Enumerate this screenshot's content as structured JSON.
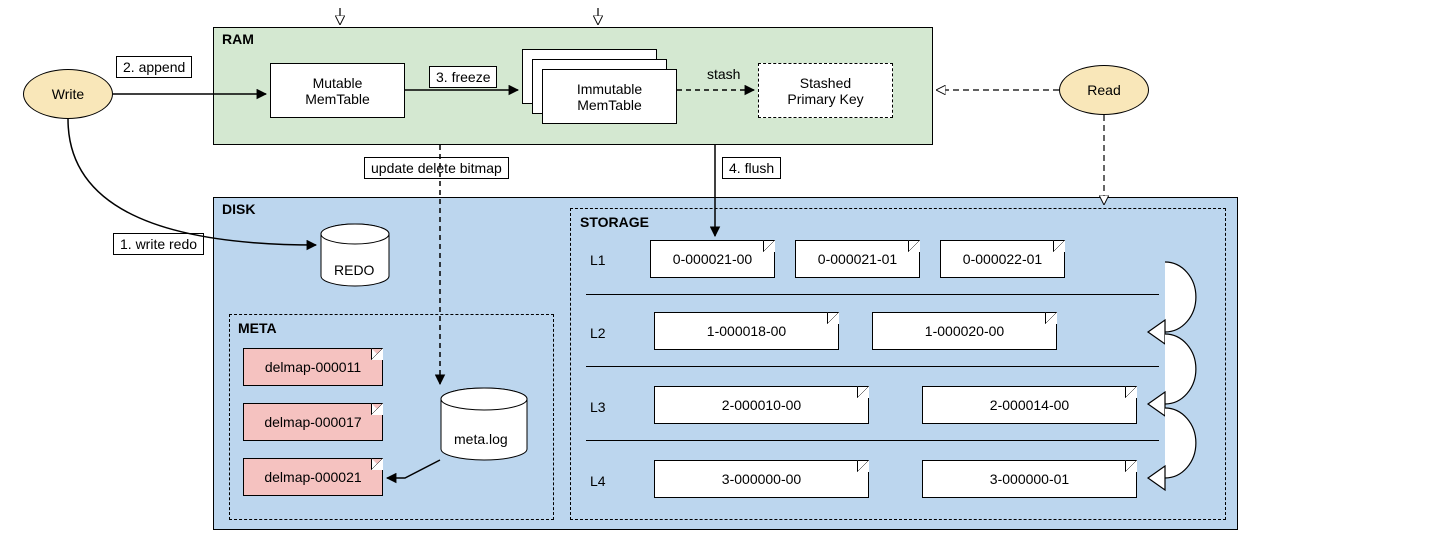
{
  "nodes": {
    "write": "Write",
    "read": "Read",
    "mutable_memtable": "Mutable\nMemTable",
    "immutable_memtable": "Immutable\nMemTable",
    "stashed_pk": "Stashed\nPrimary Key",
    "redo": "REDO",
    "metalog": "meta.log"
  },
  "regions": {
    "ram": "RAM",
    "disk": "DISK",
    "meta": "META",
    "storage": "STORAGE"
  },
  "edges": {
    "write_redo": "1. write redo",
    "append": "2. append",
    "freeze": "3. freeze",
    "stash": "stash",
    "flush": "4. flush",
    "update_delete_bitmap": "update delete bitmap"
  },
  "meta_files": [
    "delmap-000011",
    "delmap-000017",
    "delmap-000021"
  ],
  "storage_levels": [
    {
      "name": "L1",
      "files": [
        "0-000021-00",
        "0-000021-01",
        "0-000022-01"
      ]
    },
    {
      "name": "L2",
      "files": [
        "1-000018-00",
        "1-000020-00"
      ]
    },
    {
      "name": "L3",
      "files": [
        "2-000010-00",
        "2-000014-00"
      ]
    },
    {
      "name": "L4",
      "files": [
        "3-000000-00",
        "3-000000-01"
      ]
    }
  ],
  "colors": {
    "ram_bg": "#d4e8d1",
    "disk_bg": "#bcd6ee",
    "ellipse_bg": "#f9e7b9",
    "delmap_bg": "#f5c2c0"
  }
}
